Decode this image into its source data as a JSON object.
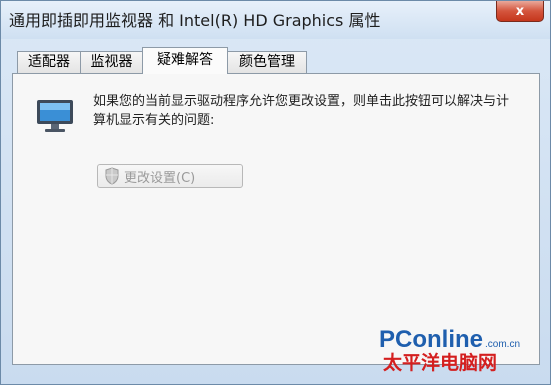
{
  "window": {
    "title": "通用即插即用监视器 和 Intel(R) HD Graphics 属性",
    "close_label": "x"
  },
  "tabs": [
    {
      "label": "适配器"
    },
    {
      "label": "监视器"
    },
    {
      "label": "疑难解答"
    },
    {
      "label": "颜色管理"
    }
  ],
  "troubleshoot": {
    "description": "如果您的当前显示驱动程序允许您更改设置，则单击此按钮可以解决与计算机显示有关的问题:",
    "change_settings_label": "更改设置(C)"
  },
  "watermark": {
    "brand": "PConline",
    "domain": ".com.cn",
    "subtitle": "太平洋电脑网"
  },
  "icons": {
    "monitor": "monitor-icon",
    "shield": "uac-shield-icon",
    "close": "close-icon"
  },
  "colors": {
    "titlebar": "#cfe0f2",
    "close_button": "#c5361c",
    "panel": "#f7f7f7",
    "watermark_blue": "#1f5fae",
    "watermark_red": "#d41f1f"
  }
}
